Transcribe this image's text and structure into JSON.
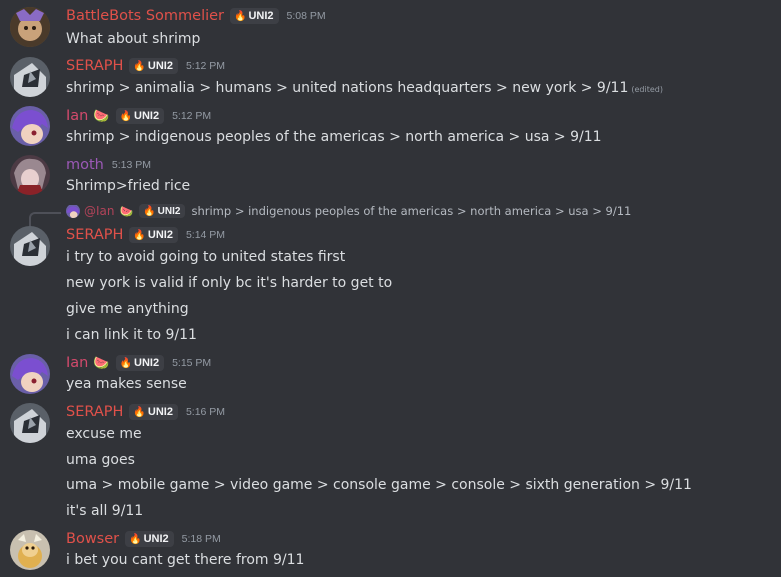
{
  "colors": {
    "background": "#313338",
    "battlebots": "#e0514a",
    "seraph": "#e0514a",
    "ian": "#d24a6c",
    "moth": "#9b59b6",
    "bowser": "#e0514a",
    "message_text": "#dbdee1",
    "timestamp": "#949ba4"
  },
  "messages": [
    {
      "username": "BattleBots Sommelier",
      "tag": "UNI2",
      "time": "5:08 PM",
      "lines": [
        "What about shrimp"
      ]
    },
    {
      "username": "SERAPH",
      "tag": "UNI2",
      "time": "5:12 PM",
      "lines": [
        "shrimp > animalia > humans > united nations headquarters > new york > 9/11"
      ],
      "edited": "(edited)"
    },
    {
      "username": "Ian",
      "emoji": "🍉",
      "tag": "UNI2",
      "time": "5:12 PM",
      "lines": [
        "shrimp > indigenous peoples of the americas > north america > usa > 9/11"
      ]
    },
    {
      "username": "moth",
      "time": "5:13 PM",
      "lines": [
        "Shrimp>fried rice"
      ]
    },
    {
      "reply": {
        "name": "@Ian",
        "emoji": "🍉",
        "tag": "UNI2",
        "text": "shrimp > indigenous peoples of the americas > north america > usa > 9/11"
      },
      "username": "SERAPH",
      "tag": "UNI2",
      "time": "5:14 PM",
      "lines": [
        "i try to avoid going to united states first",
        "new york is valid if only bc it's harder to get to",
        "give me anything",
        "i can link it to 9/11"
      ]
    },
    {
      "username": "Ian",
      "emoji": "🍉",
      "tag": "UNI2",
      "time": "5:15 PM",
      "lines": [
        "yea makes sense"
      ]
    },
    {
      "username": "SERAPH",
      "tag": "UNI2",
      "time": "5:16 PM",
      "lines": [
        "excuse me",
        "uma goes",
        "uma > mobile game > video game > console game > console > sixth generation > 9/11",
        "it's all 9/11"
      ]
    },
    {
      "username": "Bowser",
      "tag": "UNI2",
      "time": "5:18 PM",
      "lines": [
        "i bet you cant get there from 9/11"
      ]
    }
  ]
}
